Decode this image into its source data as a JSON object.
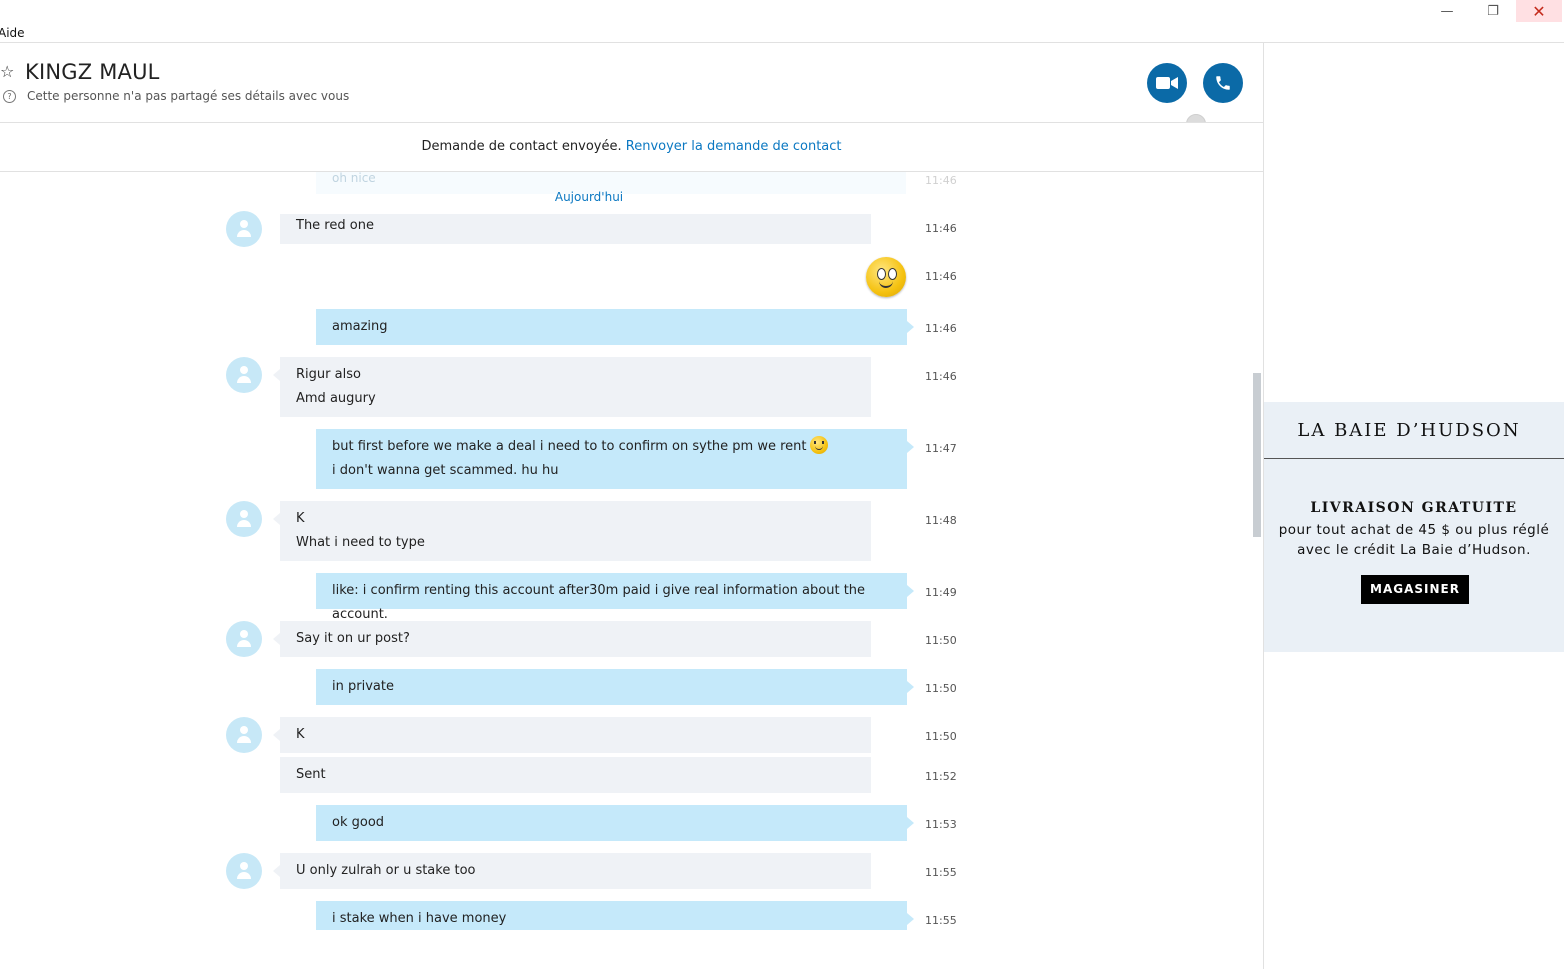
{
  "titlebar": {
    "menu_help": "Aide",
    "minimize_icon": "minimize-icon",
    "restore_icon": "restore-icon",
    "close_icon": "close-icon"
  },
  "header": {
    "contact_name": "KINGZ MAUL",
    "privacy_note": "Cette personne n'a pas partagé ses détails avec vous",
    "favorite_icon": "star-icon",
    "video_call_icon": "video-camera-icon",
    "audio_call_icon": "phone-icon",
    "accent_color": "#0b6aa7"
  },
  "contact_request": {
    "status_text": "Demande de contact envoyée.",
    "resend_link": "Renvoyer la demande de contact"
  },
  "chat": {
    "ghost_message": "oh nice",
    "ghost_time": "11:46",
    "date_separator": "Aujourd'hui",
    "messages": [
      {
        "direction": "in",
        "lines": [
          "The red one"
        ],
        "time": "11:46"
      },
      {
        "direction": "out",
        "emoji": "smile-emoticon",
        "time": "11:46"
      },
      {
        "direction": "out",
        "lines": [
          "amazing"
        ],
        "time": "11:46"
      },
      {
        "direction": "in",
        "lines": [
          "Rigur also",
          "Amd augury"
        ],
        "time": "11:46"
      },
      {
        "direction": "out",
        "lines": [
          "but first before we make a deal i need to to confirm on sythe pm we rent",
          "i don't wanna get scammed. hu hu"
        ],
        "time": "11:47"
      },
      {
        "direction": "in",
        "lines": [
          "K",
          "What i need to type"
        ],
        "time": "11:48"
      },
      {
        "direction": "out",
        "lines": [
          "like: i confirm renting this account after30m paid i give real information about the account."
        ],
        "time": "11:49"
      },
      {
        "direction": "in",
        "lines": [
          "Say it on ur post?"
        ],
        "time": "11:50"
      },
      {
        "direction": "out",
        "lines": [
          "in private"
        ],
        "time": "11:50"
      },
      {
        "direction": "in",
        "lines": [
          "K"
        ],
        "time": "11:50"
      },
      {
        "direction": "in",
        "lines": [
          "Sent"
        ],
        "time": "11:52"
      },
      {
        "direction": "out",
        "lines": [
          "ok good"
        ],
        "time": "11:53"
      },
      {
        "direction": "in",
        "lines": [
          "U only zulrah or u stake too"
        ],
        "time": "11:55"
      },
      {
        "direction": "out",
        "lines": [
          "i stake when i have money"
        ],
        "time": "11:55"
      }
    ],
    "incoming_bubble_color": "#eff2f6",
    "outgoing_bubble_color": "#c5e9fa"
  },
  "ad": {
    "brand": "LA BAIE D’HUDSON",
    "headline": "LIVRAISON GRATUITE",
    "body_line1": "pour tout achat de 45 $ ou plus réglé",
    "body_line2": "avec le crédit La Baie d’Hudson.",
    "cta": "MAGASINER"
  }
}
